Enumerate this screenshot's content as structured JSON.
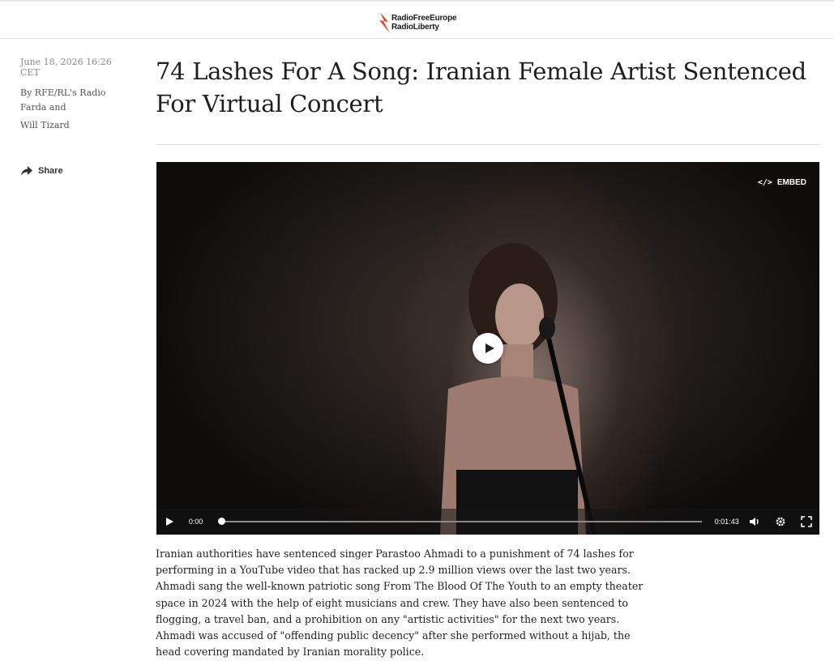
{
  "header": {
    "logo_line1": "RadioFreeEurope",
    "logo_line2": "RadioLiberty",
    "logo_color": "#e4481d"
  },
  "meta": {
    "date": "June 18, 2026 16:26 CET",
    "byline": "By RFE/RL's Radio Farda and",
    "author2": "Will Tizard",
    "share_label": "Share"
  },
  "article": {
    "title": "74 Lashes For A Song: Iranian Female Artist Sentenced For Virtual Concert",
    "body": "Iranian authorities have sentenced singer Parastoo Ahmadi to a punishment of 74 lashes for performing in a YouTube video that has racked up 2.9 million views over the last two years. Ahmadi sang the well-known patriotic song From The Blood Of The Youth to an empty theater space in 2024 with the help of eight musicians and crew. They have also been sentenced to flogging, a travel ban, and a prohibition on any \"artistic activities\" for the next two years. Ahmadi was accused of \"offending public decency\" after she performed without a hijab, the head covering mandated by Iranian morality police."
  },
  "video": {
    "embed_label": "EMBED",
    "current_time": "0:00",
    "duration": "0:01:43",
    "progress": 0,
    "icons": [
      "play-icon",
      "volume-icon",
      "settings-icon",
      "fullscreen-icon",
      "embed-icon"
    ]
  }
}
